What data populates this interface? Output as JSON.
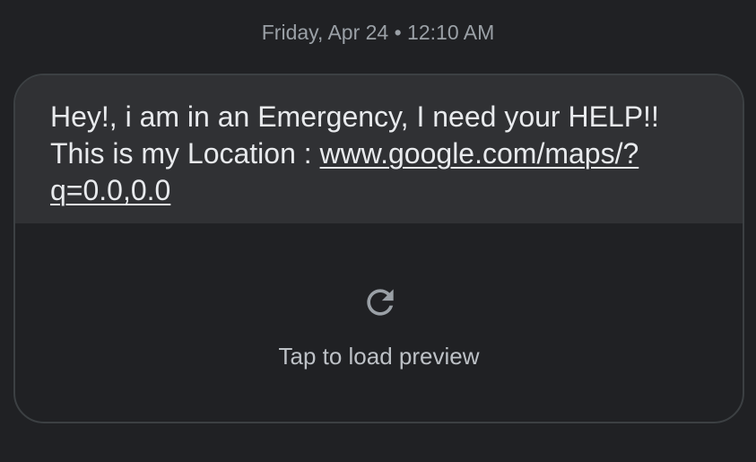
{
  "timestamp": "Friday, Apr 24 • 12:10 AM",
  "message": {
    "text_line1": "Hey!, i am in an Emergency, I need your HELP!!",
    "text_prefix": "This is my Location : ",
    "link": "www.google.com/maps/?q=0.0,0.0"
  },
  "preview": {
    "icon": "reload-icon",
    "label": "Tap to load preview"
  },
  "colors": {
    "background": "#202124",
    "bubble": "#303134",
    "text": "#e8eaed",
    "muted": "#9aa0a6"
  }
}
